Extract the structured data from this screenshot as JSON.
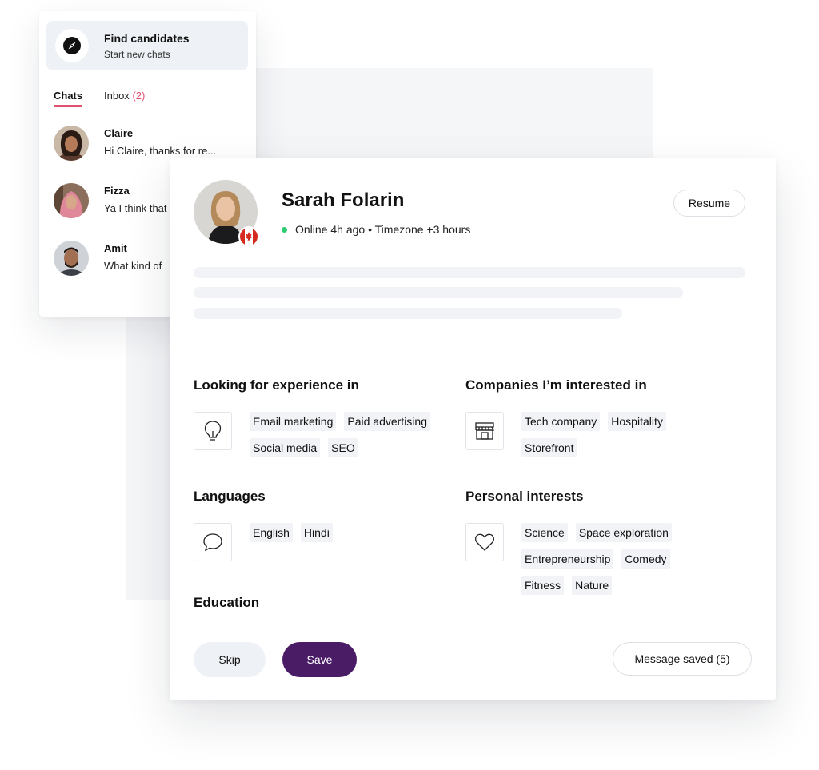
{
  "sidebar": {
    "find_title": "Find candidates",
    "find_subtitle": "Start new chats",
    "tab_chats": "Chats",
    "tab_inbox": "Inbox",
    "inbox_count": "(2)",
    "chats": [
      {
        "name": "Claire",
        "message": "Hi Claire, thanks for re..."
      },
      {
        "name": "Fizza",
        "message": "Ya I think that"
      },
      {
        "name": "Amit",
        "message": "What kind of"
      }
    ]
  },
  "profile": {
    "name": "Sarah Folarin",
    "status": "Online 4h ago • Timezone +3 hours",
    "resume_label": "Resume",
    "sections": {
      "experience": {
        "title": "Looking for experience in",
        "tags": [
          "Email marketing",
          "Paid advertising",
          "Social media",
          "SEO"
        ]
      },
      "companies": {
        "title": "Companies I’m interested in",
        "tags": [
          "Tech company",
          "Hospitality",
          "Storefront"
        ]
      },
      "languages": {
        "title": "Languages",
        "tags": [
          "English",
          "Hindi"
        ]
      },
      "interests": {
        "title": "Personal interests",
        "tags": [
          "Science",
          "Space exploration",
          "Entrepreneurship",
          "Comedy",
          "Fitness",
          "Nature"
        ]
      },
      "education": {
        "title": "Education"
      }
    },
    "actions": {
      "skip": "Skip",
      "save": "Save",
      "message_saved": "Message saved (5)"
    }
  },
  "colors": {
    "accent": "#e0506f",
    "save_button": "#4a1c66",
    "online": "#2ecc71"
  }
}
